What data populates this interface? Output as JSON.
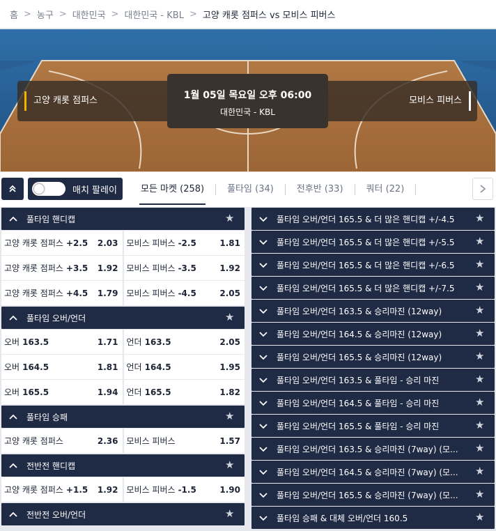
{
  "breadcrumb": {
    "items": [
      "홈",
      "농구",
      "대한민국",
      "대한민국 - KBL"
    ],
    "current": "고양 캐롯 점퍼스 vs 모비스 피버스"
  },
  "hero": {
    "home_team": "고양 캐롯 점퍼스",
    "away_team": "모비스 피버스",
    "datetime": "1월 05일 목요일 오후 06:00",
    "league": "대한민국 - KBL"
  },
  "tabbar": {
    "match_play_label": "매치 팔레이",
    "tabs": [
      {
        "label": "모든 마켓",
        "count": "(258)"
      },
      {
        "label": "풀타임",
        "count": "(34)"
      },
      {
        "label": "전후반",
        "count": "(33)"
      },
      {
        "label": "쿼터",
        "count": "(22)"
      }
    ]
  },
  "left_markets": [
    {
      "title": "풀타임 핸디캡",
      "rows": [
        [
          {
            "label": "고양 캐롯 점퍼스",
            "line": "+2.5",
            "price": "2.03"
          },
          {
            "label": "모비스 피버스",
            "line": "-2.5",
            "price": "1.81"
          }
        ],
        [
          {
            "label": "고양 캐롯 점퍼스",
            "line": "+3.5",
            "price": "1.92"
          },
          {
            "label": "모비스 피버스",
            "line": "-3.5",
            "price": "1.92"
          }
        ],
        [
          {
            "label": "고양 캐롯 점퍼스",
            "line": "+4.5",
            "price": "1.79"
          },
          {
            "label": "모비스 피버스",
            "line": "-4.5",
            "price": "2.05"
          }
        ]
      ]
    },
    {
      "title": "풀타임 오버/언더",
      "rows": [
        [
          {
            "label": "오버",
            "line": "163.5",
            "price": "1.71"
          },
          {
            "label": "언더",
            "line": "163.5",
            "price": "2.05"
          }
        ],
        [
          {
            "label": "오버",
            "line": "164.5",
            "price": "1.81"
          },
          {
            "label": "언더",
            "line": "164.5",
            "price": "1.95"
          }
        ],
        [
          {
            "label": "오버",
            "line": "165.5",
            "price": "1.94"
          },
          {
            "label": "언더",
            "line": "165.5",
            "price": "1.82"
          }
        ]
      ]
    },
    {
      "title": "풀타임 승패",
      "rows": [
        [
          {
            "label": "고양 캐롯 점퍼스",
            "line": "",
            "price": "2.36"
          },
          {
            "label": "모비스 피버스",
            "line": "",
            "price": "1.57"
          }
        ]
      ]
    },
    {
      "title": "전반전 핸디캡",
      "rows": [
        [
          {
            "label": "고양 캐롯 점퍼스",
            "line": "+1.5",
            "price": "1.92"
          },
          {
            "label": "모비스 피버스",
            "line": "-1.5",
            "price": "1.90"
          }
        ]
      ]
    },
    {
      "title": "전반전 오버/언더",
      "rows": []
    }
  ],
  "right_markets": [
    "풀타임 오버/언더 165.5 & 더 많은 핸디캡 +/-4.5",
    "풀타임 오버/언더 165.5 & 더 많은 핸디캡 +/-5.5",
    "풀타임 오버/언더 165.5 & 더 많은 핸디캡 +/-6.5",
    "풀타임 오버/언더 165.5 & 더 많은 핸디캡 +/-7.5",
    "풀타임 오버/언더 163.5 & 승리마진 (12way)",
    "풀타임 오버/언더 164.5 & 승리마진 (12way)",
    "풀타임 오버/언더 165.5 & 승리마진 (12way)",
    "풀타임 오버/언더 163.5 & 풀타임 - 승리 마진",
    "풀타임 오버/언더 164.5 & 풀타임 - 승리 마진",
    "풀타임 오버/언더 165.5 & 풀타임 - 승리 마진",
    "풀타임 오버/언더 163.5 & 승리마진 (7way) (모...",
    "풀타임 오버/언더 164.5 & 승리마진 (7way) (모...",
    "풀타임 오버/언더 165.5 & 승리마진 (7way) (모...",
    "풀타임 승패 & 대체 오버/언더 160.5"
  ],
  "colors": {
    "header_navy": "#1f2a44",
    "court": "#a8703e",
    "home_accent": "#f0b400"
  }
}
